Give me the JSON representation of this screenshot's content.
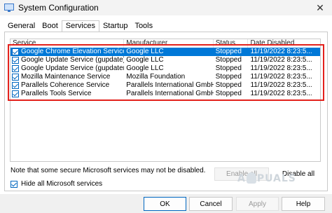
{
  "window": {
    "title": "System Configuration",
    "close_glyph": "✕"
  },
  "tabs": [
    {
      "label": "General",
      "active": false
    },
    {
      "label": "Boot",
      "active": false
    },
    {
      "label": "Services",
      "active": true
    },
    {
      "label": "Startup",
      "active": false
    },
    {
      "label": "Tools",
      "active": false
    }
  ],
  "services_table": {
    "columns": [
      "Service",
      "Manufacturer",
      "Status",
      "Date Disabled"
    ],
    "rows": [
      {
        "checked": true,
        "service": "Google Chrome Elevation Service (...",
        "manufacturer": "Google LLC",
        "status": "Stopped",
        "date": "11/19/2022 8:23:5...",
        "selected": true
      },
      {
        "checked": true,
        "service": "Google Update Service (gupdate)",
        "manufacturer": "Google LLC",
        "status": "Stopped",
        "date": "11/19/2022 8:23:5...",
        "selected": false
      },
      {
        "checked": true,
        "service": "Google Update Service (gupdatem)",
        "manufacturer": "Google LLC",
        "status": "Stopped",
        "date": "11/19/2022 8:23:5...",
        "selected": false
      },
      {
        "checked": true,
        "service": "Mozilla Maintenance Service",
        "manufacturer": "Mozilla Foundation",
        "status": "Stopped",
        "date": "11/19/2022 8:23:5...",
        "selected": false
      },
      {
        "checked": true,
        "service": "Parallels Coherence Service",
        "manufacturer": "Parallels International GmbH",
        "status": "Stopped",
        "date": "11/19/2022 8:23:5...",
        "selected": false
      },
      {
        "checked": true,
        "service": "Parallels Tools Service",
        "manufacturer": "Parallels International GmbH",
        "status": "Stopped",
        "date": "11/19/2022 8:23:5...",
        "selected": false
      }
    ]
  },
  "note": "Note that some secure Microsoft services may not be disabled.",
  "enable_all_label": "Enable all",
  "disable_all_label": "Disable all",
  "hide_ms": {
    "label": "Hide all Microsoft services",
    "checked": true
  },
  "watermark": {
    "left": "A",
    "right": "PUALS"
  },
  "buttons": {
    "ok": "OK",
    "cancel": "Cancel",
    "apply": "Apply",
    "help": "Help"
  },
  "colors": {
    "selection": "#0078d7",
    "highlight_border": "#e3211c",
    "checkbox": "#0067c0"
  },
  "icons": {
    "app": "system-config-icon",
    "check": "checkmark-icon",
    "close": "close-icon"
  }
}
